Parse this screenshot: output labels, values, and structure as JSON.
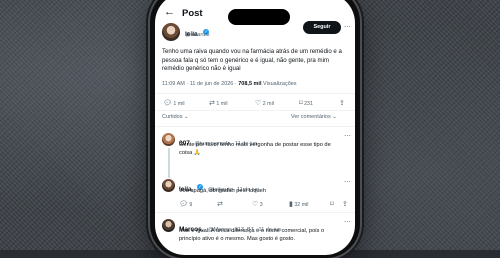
{
  "header": {
    "title": "Post",
    "back_icon": "arrow-left-icon"
  },
  "post": {
    "name": "leila",
    "handle": "@leilaruts",
    "follow_label": "Seguir",
    "text": "Tenho uma raiva quando vou na farmácia atrás de um remédio e a pessoa fala q só tem o genérico e é igual, não gente, pra mim remédio genérico não é igual",
    "time": "11:09 AM · 11 de jun de 2026 ·",
    "views_count": "708,5 mil",
    "views_label": "Visualizações",
    "stats": {
      "replies": "1 mil",
      "reposts": "1 mil",
      "likes": "2 mil",
      "bookmarks": "231"
    }
  },
  "sort": {
    "left": "Curtidos",
    "right": "Ver comentários"
  },
  "replies": [
    {
      "name": "007",
      "handle": "@tuannymoda · 11 de jun",
      "text": "Gente por favor tenho mais vergonha de postar esse tipo de coisa 🙏",
      "stats": {
        "replies": "",
        "reposts": "",
        "likes": "",
        "views": ""
      }
    },
    {
      "name": "leila",
      "handle": "@leilaruts · 11 de jun",
      "text": "Vou apagá, obrigadah pelo toqueh",
      "stats": {
        "replies": "9",
        "reposts": "",
        "likes": "3",
        "views": "32 mil"
      }
    },
    {
      "name": "Marcos.",
      "handle": "@Marcos_013_B7 · 11 de jun",
      "text": "Mas é igual. A única diferença é o nome comercial, pois o princípio ativo é o mesmo. Mas gosto é gosto.",
      "stats": {
        "replies": "4",
        "reposts": "1",
        "likes": "56",
        "views": "1 mil"
      }
    }
  ],
  "colors": {
    "accent": "#1d9bf0",
    "text": "#0f1419",
    "muted": "#536471"
  }
}
